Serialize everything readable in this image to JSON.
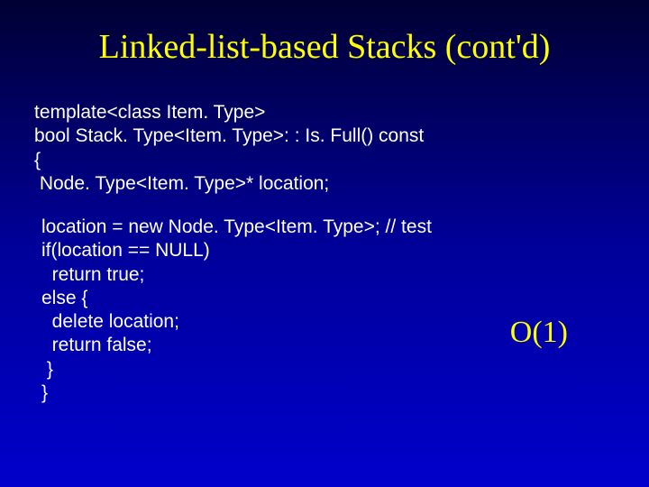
{
  "title": "Linked-list-based Stacks (cont'd)",
  "code": {
    "line1": "template<class Item. Type>",
    "line2": "bool Stack. Type<Item. Type>: : Is. Full() const",
    "line3": "{",
    "line4": " Node. Type<Item. Type>* location;",
    "line5": "location = new Node. Type<Item. Type>; // test",
    "line6": "if(location == NULL)",
    "line7": "  return true;",
    "line8": "else {",
    "line9": "  delete location;",
    "line10": "  return false;",
    "line11": " }",
    "line12": "}"
  },
  "complexity": "O(1)"
}
